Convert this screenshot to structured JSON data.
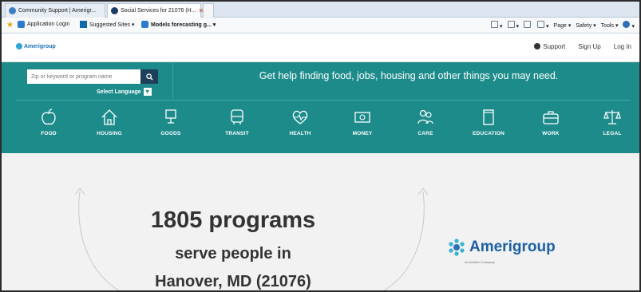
{
  "browser": {
    "tabs": [
      {
        "label": "Community Support | Amerigr...",
        "active": false
      },
      {
        "label": "Social Services for 21076 (H...",
        "active": true
      },
      {
        "label": "",
        "active": false
      }
    ],
    "favorites": [
      {
        "label": "Application Login"
      },
      {
        "label": "Suggested Sites ▾"
      },
      {
        "label": "Models forecasting g... ▾"
      }
    ],
    "tools": {
      "page": "Page ▾",
      "safety": "Safety ▾",
      "tools": "Tools ▾"
    }
  },
  "header": {
    "logo_text": "Amerigroup",
    "links": {
      "support": "Support",
      "signup": "Sign Up",
      "login": "Log In"
    }
  },
  "search": {
    "placeholder": "Zip or keyword or program name",
    "language_label": "Select Language"
  },
  "tagline": "Get help finding food, jobs, housing and other things you may need.",
  "categories": [
    {
      "label": "FOOD",
      "icon": "apple-icon"
    },
    {
      "label": "HOUSING",
      "icon": "house-icon"
    },
    {
      "label": "GOODS",
      "icon": "lamp-icon"
    },
    {
      "label": "TRANSIT",
      "icon": "bus-icon"
    },
    {
      "label": "HEALTH",
      "icon": "heart-pulse-icon"
    },
    {
      "label": "MONEY",
      "icon": "money-icon"
    },
    {
      "label": "CARE",
      "icon": "people-icon"
    },
    {
      "label": "EDUCATION",
      "icon": "book-icon"
    },
    {
      "label": "WORK",
      "icon": "briefcase-icon"
    },
    {
      "label": "LEGAL",
      "icon": "scales-icon"
    }
  ],
  "hero": {
    "count": "1805 programs",
    "line2": "serve people in",
    "line3": "Hanover, MD (21076)"
  },
  "brand": {
    "name": "Amerigroup",
    "sub": "An Anthem Company"
  },
  "colors": {
    "teal": "#1e8b8b",
    "search_button": "#1d3f5a",
    "brand_blue": "#1d5fa8"
  }
}
